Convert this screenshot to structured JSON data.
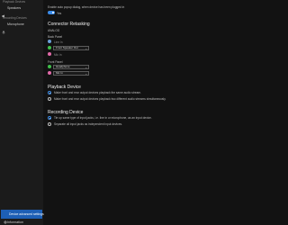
{
  "sidebar": {
    "playback_section": "Playback Devices",
    "speakers_label": "Speakers",
    "recording_section": "Recording Devices",
    "microphone_label": "Microphone",
    "advanced_button": "Device advanced settings",
    "information_label": "Information"
  },
  "main": {
    "enable_popup_text": "Enable auto popup dialog, when device has been plugged in",
    "popup_toggle_state": "Yes",
    "connector_title": "Connector Retasking",
    "analog_label": "ANALOG",
    "back_panel_label": "Back Panel",
    "back_items": [
      "Line In",
      "Front Speaker Out",
      "Mic In"
    ],
    "front_panel_label": "Front Panel",
    "front_items": [
      "Headphone",
      "Mic In"
    ],
    "playback_title": "Playback Device",
    "playback_options": [
      "Make front and rear output devices playback the same audio stream.",
      "Make front and rear output devices playback two different audio streams simultaneously."
    ],
    "recording_title": "Recording Device",
    "recording_options": [
      "Tie up same type of input jacks, i.e. line in or microphone, as an input device.",
      "Separate all input jacks as independent input devices."
    ]
  },
  "colors": {
    "accent": "#3a8be8",
    "button": "#1d5fb5",
    "green_jack": "#3fbf4a",
    "pink_jack": "#e26aa9",
    "blue_jack": "#3b76d9"
  }
}
